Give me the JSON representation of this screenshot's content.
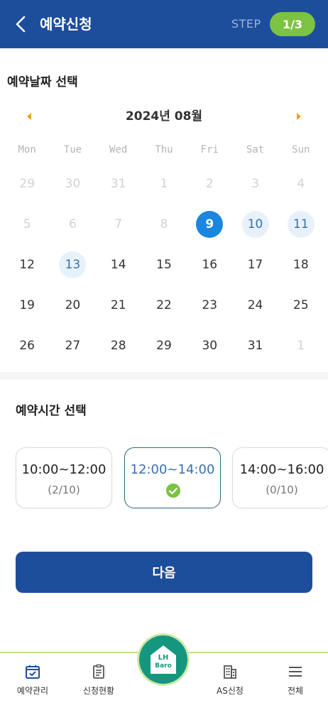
{
  "header": {
    "title": "예약신청",
    "step_label": "STEP",
    "step_value": "1/3"
  },
  "date_section": {
    "title": "예약날짜 선택"
  },
  "calendar": {
    "month": "2024년  08월",
    "weekdays": [
      "Mon",
      "Tue",
      "Wed",
      "Thu",
      "Fri",
      "Sat",
      "Sun"
    ],
    "weeks": [
      [
        {
          "d": "29",
          "s": "muted"
        },
        {
          "d": "30",
          "s": "muted"
        },
        {
          "d": "31",
          "s": "muted"
        },
        {
          "d": "1",
          "s": "muted"
        },
        {
          "d": "2",
          "s": "muted"
        },
        {
          "d": "3",
          "s": "muted"
        },
        {
          "d": "4",
          "s": "muted"
        }
      ],
      [
        {
          "d": "5",
          "s": "muted"
        },
        {
          "d": "6",
          "s": "muted"
        },
        {
          "d": "7",
          "s": "muted"
        },
        {
          "d": "8",
          "s": "muted"
        },
        {
          "d": "9",
          "s": "sel"
        },
        {
          "d": "10",
          "s": "avail"
        },
        {
          "d": "11",
          "s": "avail"
        }
      ],
      [
        {
          "d": "12",
          "s": ""
        },
        {
          "d": "13",
          "s": "avail"
        },
        {
          "d": "14",
          "s": ""
        },
        {
          "d": "15",
          "s": ""
        },
        {
          "d": "16",
          "s": ""
        },
        {
          "d": "17",
          "s": ""
        },
        {
          "d": "18",
          "s": ""
        }
      ],
      [
        {
          "d": "19",
          "s": ""
        },
        {
          "d": "20",
          "s": ""
        },
        {
          "d": "21",
          "s": ""
        },
        {
          "d": "22",
          "s": ""
        },
        {
          "d": "23",
          "s": ""
        },
        {
          "d": "24",
          "s": ""
        },
        {
          "d": "25",
          "s": ""
        }
      ],
      [
        {
          "d": "26",
          "s": ""
        },
        {
          "d": "27",
          "s": ""
        },
        {
          "d": "28",
          "s": ""
        },
        {
          "d": "29",
          "s": ""
        },
        {
          "d": "30",
          "s": ""
        },
        {
          "d": "31",
          "s": ""
        },
        {
          "d": "1",
          "s": "muted"
        }
      ]
    ]
  },
  "time_section": {
    "title": "예약시간 선택",
    "slots": [
      {
        "time": "10:00~12:00",
        "count": "(2/10)"
      },
      {
        "time": "12:00~14:00",
        "selected": true
      },
      {
        "time": "14:00~16:00",
        "count": "(0/10)"
      }
    ]
  },
  "next_button": {
    "label": "다음"
  },
  "bottom_nav": {
    "items": [
      {
        "label": "예약관리",
        "icon": "calendar-check-icon"
      },
      {
        "label": "신청현황",
        "icon": "clipboard-icon"
      },
      {
        "label": "AS신청",
        "icon": "building-icon"
      },
      {
        "label": "전체",
        "icon": "menu-icon"
      }
    ],
    "home": {
      "line1": "LH",
      "line2": "Baro"
    }
  },
  "colors": {
    "primary": "#1d4e9b",
    "accent_green": "#7cc243",
    "selected_day": "#1b86e0",
    "home_teal": "#14977e"
  }
}
